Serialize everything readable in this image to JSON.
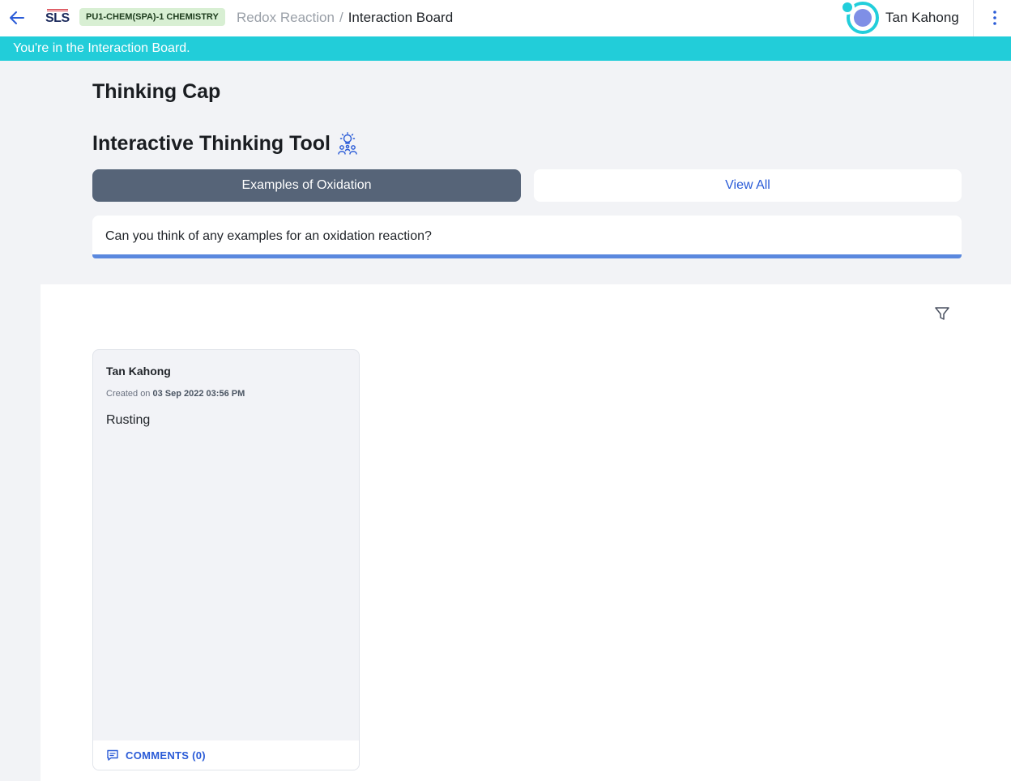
{
  "header": {
    "logo_text": "SLS",
    "course_badge": "PU1-CHEM(SPA)-1 CHEMISTRY",
    "breadcrumb": {
      "parent": "Redox Reaction",
      "separator": "/",
      "current": "Interaction Board"
    },
    "user_name": "Tan Kahong"
  },
  "banner": {
    "text": "You're in the Interaction Board."
  },
  "main": {
    "page_title": "Thinking Cap",
    "tool_title": "Interactive Thinking Tool",
    "tabs": [
      {
        "label": "Examples of Oxidation",
        "active": true
      },
      {
        "label": "View All",
        "active": false
      }
    ],
    "prompt": "Can you think of any examples for an oxidation reaction?"
  },
  "board": {
    "posts": [
      {
        "author": "Tan Kahong",
        "created_prefix": "Created on",
        "created_at": "03 Sep 2022 03:56 PM",
        "content": "Rusting",
        "comments_label": "COMMENTS (0)"
      }
    ]
  },
  "colors": {
    "accent_teal": "#22cdd9",
    "link_blue": "#2a5bd7",
    "tab_active": "#566478",
    "prompt_underline": "#5a88de",
    "badge_bg": "#d8efd3"
  },
  "icons": {
    "back": "arrow-left-icon",
    "menu": "kebab-menu-icon",
    "tool": "thinking-group-icon",
    "filter": "filter-funnel-icon",
    "comment": "comment-bubble-icon"
  }
}
